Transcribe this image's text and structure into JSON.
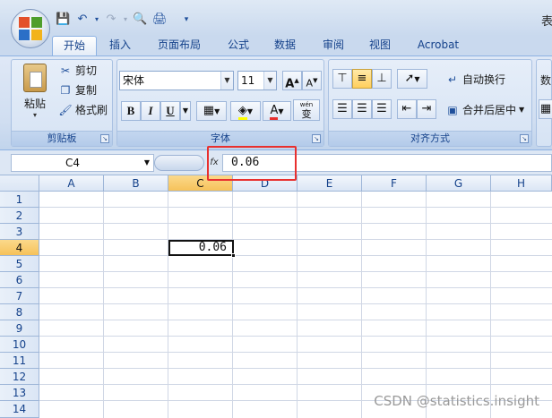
{
  "titlebar": {
    "title_fragment": "表"
  },
  "quick_access": [
    "save-icon",
    "undo-icon",
    "redo-icon",
    "print-preview-icon",
    "print-icon",
    "customize-icon"
  ],
  "tabs": [
    {
      "label": "开始",
      "active": true
    },
    {
      "label": "插入"
    },
    {
      "label": "页面布局"
    },
    {
      "label": "公式"
    },
    {
      "label": "数据"
    },
    {
      "label": "审阅"
    },
    {
      "label": "视图"
    },
    {
      "label": "Acrobat"
    }
  ],
  "clipboard": {
    "paste": "粘贴",
    "cut": "剪切",
    "copy": "复制",
    "format_painter": "格式刷",
    "group_label": "剪贴板"
  },
  "font": {
    "name": "宋体",
    "size": "11",
    "bold": "B",
    "italic": "I",
    "underline": "U",
    "grow": "A",
    "shrink": "A",
    "font_color": "A",
    "phonetic": "wén",
    "phonetic_char": "变",
    "group_label": "字体"
  },
  "alignment": {
    "wrap_text": "自动换行",
    "merge_center": "合并后居中",
    "group_label": "对齐方式"
  },
  "number": {
    "partial_label": "数"
  },
  "formula_bar": {
    "name_box": "C4",
    "fx": "fx",
    "value": "0.06"
  },
  "grid": {
    "columns": [
      "A",
      "B",
      "C",
      "D",
      "E",
      "F",
      "G",
      "H"
    ],
    "rows": [
      "1",
      "2",
      "3",
      "4",
      "5",
      "6",
      "7",
      "8",
      "9",
      "10",
      "11",
      "12",
      "13",
      "14"
    ],
    "selected_column": "C",
    "selected_row": "4",
    "active_cell_value": "0.06"
  },
  "watermark": "CSDN @statistics.insight",
  "colors": {
    "highlight_box": "#e8302f",
    "selected_header": "#f6c25a"
  }
}
